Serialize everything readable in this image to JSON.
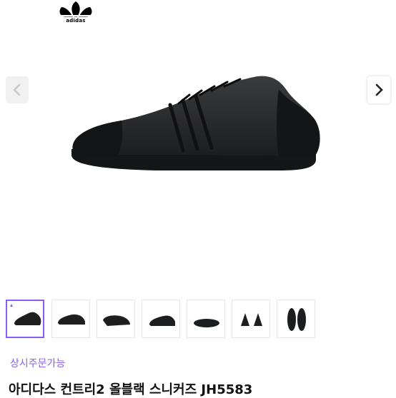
{
  "brand": {
    "name": "adidas",
    "logo_icon": "adidas-trefoil-icon"
  },
  "gallery": {
    "hero_alt": "black sneaker side view",
    "prev_icon": "chevron-left-icon",
    "next_icon": "chevron-right-icon",
    "selected_index": 0,
    "thumbnail_count": 7,
    "accent_color": "#8b5cf6"
  },
  "product": {
    "status": "상시주문가능",
    "title": "아디다스 컨트리2 올블랙 스니커즈 JH5583"
  }
}
